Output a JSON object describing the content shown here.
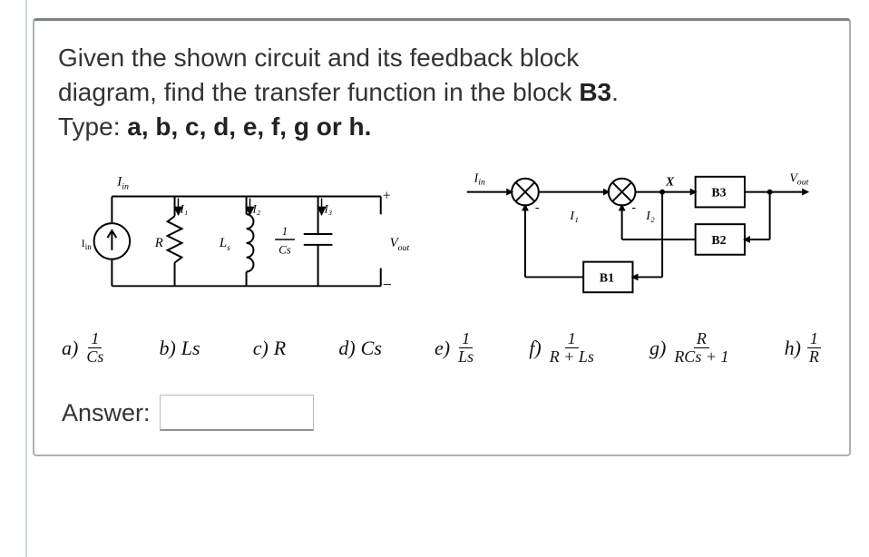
{
  "question": {
    "line1": "Given the shown circuit and its feedback block",
    "line2_a": "diagram, find the transfer function in the block ",
    "line2_b": "B3",
    "line2_c": ".",
    "line3_a": "Type: ",
    "line3_b": "a, b, c, d, e, f, g or h."
  },
  "circuit": {
    "Iin": "I",
    "Iin_sub": "in",
    "I1": "I₁",
    "I2": "I₂",
    "I3": "I₃",
    "R": "R",
    "Ls": "L",
    "Ls_sub": "s",
    "Cs_num": "1",
    "Cs_den": "Cs",
    "Vout": "V",
    "Vout_sub": "out",
    "plus": "+",
    "minus": "−",
    "arrow_up": "↑",
    "arrow_down": "↓"
  },
  "block": {
    "Iin": "I",
    "Iin_sub": "in",
    "I1": "I₁",
    "I2": "I₂",
    "X": "X",
    "B1": "B1",
    "B2": "B2",
    "B3": "B3",
    "Vout": "V",
    "Vout_sub": "out"
  },
  "options": {
    "a": {
      "label": "a)",
      "num": "1",
      "den": "Cs"
    },
    "b": {
      "label": "b)",
      "value": "Ls"
    },
    "c": {
      "label": "c)",
      "value": "R"
    },
    "d": {
      "label": "d)",
      "value": "Cs"
    },
    "e": {
      "label": "e)",
      "num": "1",
      "den": "Ls"
    },
    "f": {
      "label": "f)",
      "num": "1",
      "den": "R + Ls"
    },
    "g": {
      "label": "g)",
      "num": "R",
      "den": "RCs + 1"
    },
    "h": {
      "label": "h)",
      "num": "1",
      "den": "R"
    }
  },
  "answer": {
    "label": "Answer:",
    "value": ""
  }
}
